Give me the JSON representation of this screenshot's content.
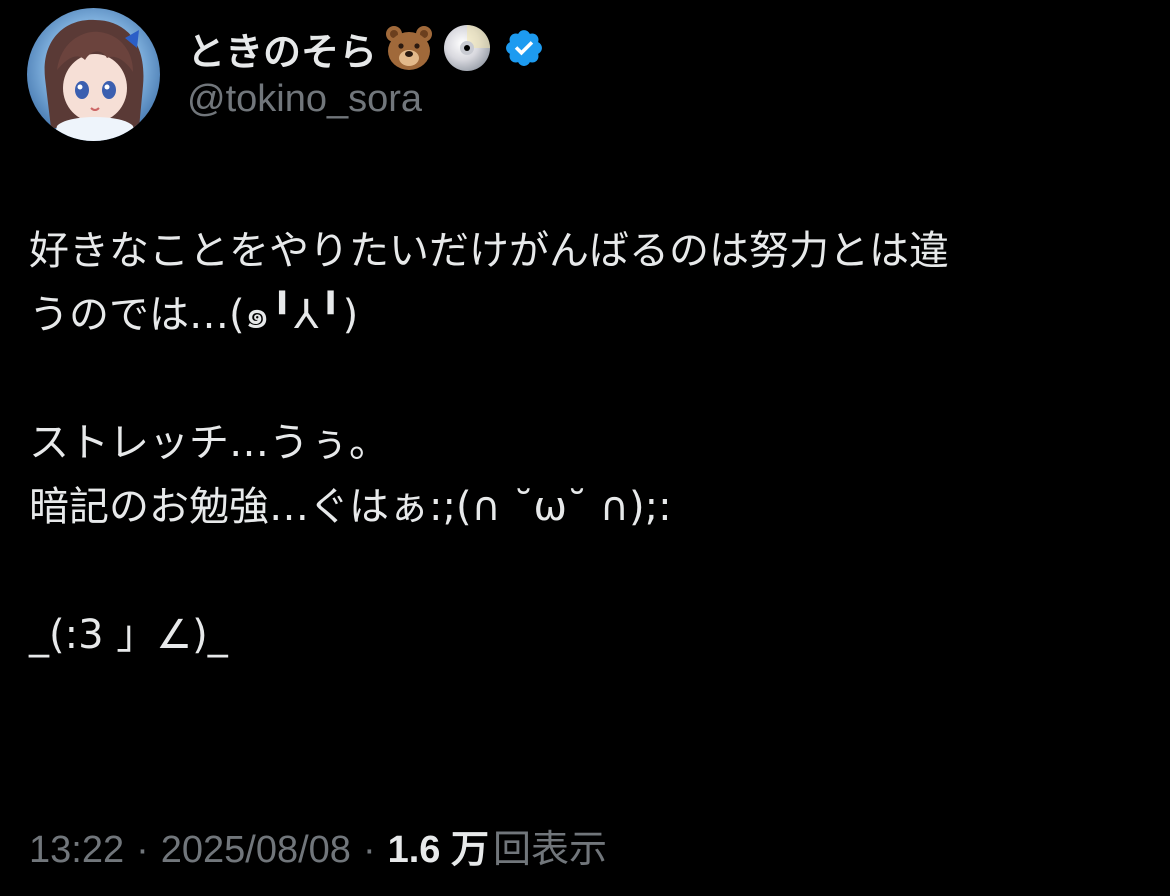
{
  "author": {
    "display_name": "ときのそら",
    "emoji_1": "bear-face-emoji",
    "emoji_2": "dvd-disc-emoji",
    "verified_badge": "verified-badge-icon",
    "handle": "@tokino_sora"
  },
  "tweet": {
    "lines": [
      "好きなことをやりたいだけがんばるのは努力とは違",
      "うのでは…(๑╹⅄╹)",
      "",
      "ストレッチ…うぅ。",
      "暗記のお勉強…ぐはぁ:;(∩ ˘ω˘ ∩);:",
      "",
      "_(:3 」∠)_"
    ]
  },
  "meta": {
    "time": "13:22",
    "separator": "·",
    "date": "2025/08/08",
    "views_count": "1.6 万",
    "views_label": "回表示"
  },
  "colors": {
    "background": "#000000",
    "primary_text": "#e7e9ea",
    "secondary_text": "#71767b",
    "verified_blue": "#1d9bf0"
  }
}
